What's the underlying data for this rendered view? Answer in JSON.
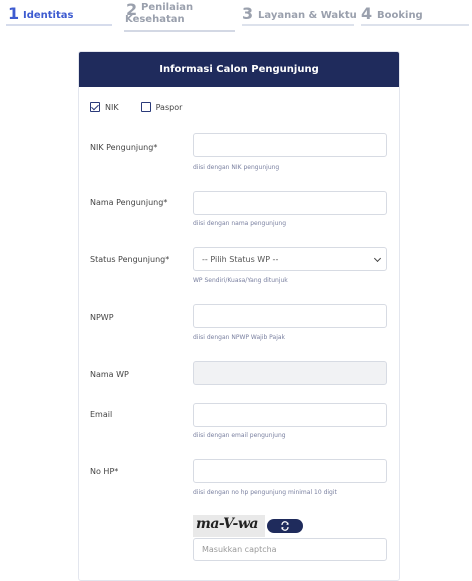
{
  "steps": [
    {
      "num": "1",
      "label": "Identitas"
    },
    {
      "num": "2",
      "label": "Penilaian Kesehatan"
    },
    {
      "num": "3",
      "label": "Layanan & Waktu"
    },
    {
      "num": "4",
      "label": "Booking"
    }
  ],
  "card": {
    "title": "Informasi Calon Pengunjung",
    "id_types": [
      {
        "label": "NIK",
        "checked": true
      },
      {
        "label": "Paspor",
        "checked": false
      }
    ],
    "fields": {
      "nik": {
        "label": "NIK Pengunjung*",
        "value": "",
        "hint": "diisi dengan NIK pengunjung"
      },
      "nama": {
        "label": "Nama Pengunjung*",
        "value": "",
        "hint": "diisi dengan nama pengunjung"
      },
      "status": {
        "label": "Status Pengunjung*",
        "selected": "-- Pilih Status WP --",
        "hint": "WP Sendiri/Kuasa/Yang ditunjuk"
      },
      "npwp": {
        "label": "NPWP",
        "value": "",
        "hint": "diisi dengan NPWP Wajib Pajak"
      },
      "nama_wp": {
        "label": "Nama WP",
        "value": ""
      },
      "email": {
        "label": "Email",
        "value": "",
        "hint": "diisi dengan email pengunjung"
      },
      "hp": {
        "label": "No HP*",
        "value": "",
        "hint": "diisi dengan no hp pengunjung minimal 10 digit"
      }
    },
    "captcha": {
      "text": "ma-V-wa",
      "placeholder": "Masukkan captcha"
    }
  },
  "colors": {
    "header_bg": "#1f2b5c",
    "active_step": "#3d5bd0",
    "inactive_step": "#9aa0ad"
  }
}
